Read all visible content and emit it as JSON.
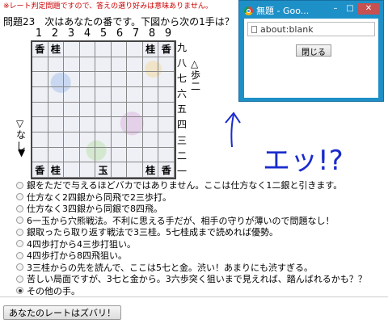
{
  "top_note": "※レート判定問題ですので、答えの選り好みは意味ありません。",
  "question": "問題23　次はあなたの番です。下図から次の1手は？",
  "board": {
    "col_numbers": [
      "1",
      "2",
      "3",
      "4",
      "5",
      "6",
      "7",
      "8",
      "9"
    ],
    "row_numbers": [
      "九",
      "八",
      "七",
      "六",
      "五",
      "四",
      "三",
      "二",
      "一"
    ],
    "cells": [
      [
        "香",
        "桂",
        "",
        "",
        "",
        "",
        "",
        "桂",
        "香"
      ],
      [
        "",
        "",
        "",
        "",
        "",
        "",
        "",
        "",
        ""
      ],
      [
        "",
        "",
        "",
        "",
        "",
        "",
        "",
        "",
        ""
      ],
      [
        "",
        "",
        "",
        "",
        "",
        "",
        "",
        "",
        ""
      ],
      [
        "",
        "",
        "",
        "",
        "",
        "",
        "",
        "",
        ""
      ],
      [
        "",
        "",
        "",
        "",
        "",
        "",
        "",
        "",
        ""
      ],
      [
        "",
        "",
        "",
        "",
        "",
        "",
        "",
        "",
        ""
      ],
      [
        "",
        "",
        "",
        "",
        "",
        "",
        "",
        "",
        ""
      ],
      [
        "香",
        "桂",
        "",
        "",
        "玉",
        "",
        "",
        "桂",
        "香"
      ]
    ]
  },
  "hand_right": [
    "△",
    "歩",
    "二"
  ],
  "hand_left": [
    "▽",
    "な",
    "し"
  ],
  "turn_marker": "▼",
  "options": [
    "銀をただで与えるほどバカではありません。ここは仕方なく1二銀と引きます。",
    "仕方なく2四銀から同飛で2三歩打。",
    "仕方なく3四銀から同銀で8四飛。",
    "6一玉から穴熊戦法。不利に思える手だが、相手の守りが薄いので問題なし！",
    "銀取ったら取り返す戦法で3三桂。5七桂成まで読めれば優勢。",
    "4四歩打から4三歩打狙い。",
    "4四歩打から8四飛狙い。",
    "3三桂からの先を読んで、ここは5七と金。渋い！あまりにも渋すぎる。",
    "苦しい局面ですが、3七と金から。3六歩突く狙いまで見えれば、踏んばれるかも？？",
    "その他の手。"
  ],
  "selected_option": 9,
  "rate_button_label": "あなたのレートはズバリ！",
  "popup": {
    "title": "無題 - Goo...",
    "url": "about:blank",
    "close_button": "閉じる"
  },
  "handwriting_text": "エッ!?",
  "annotation_color": "#1a2bcc"
}
